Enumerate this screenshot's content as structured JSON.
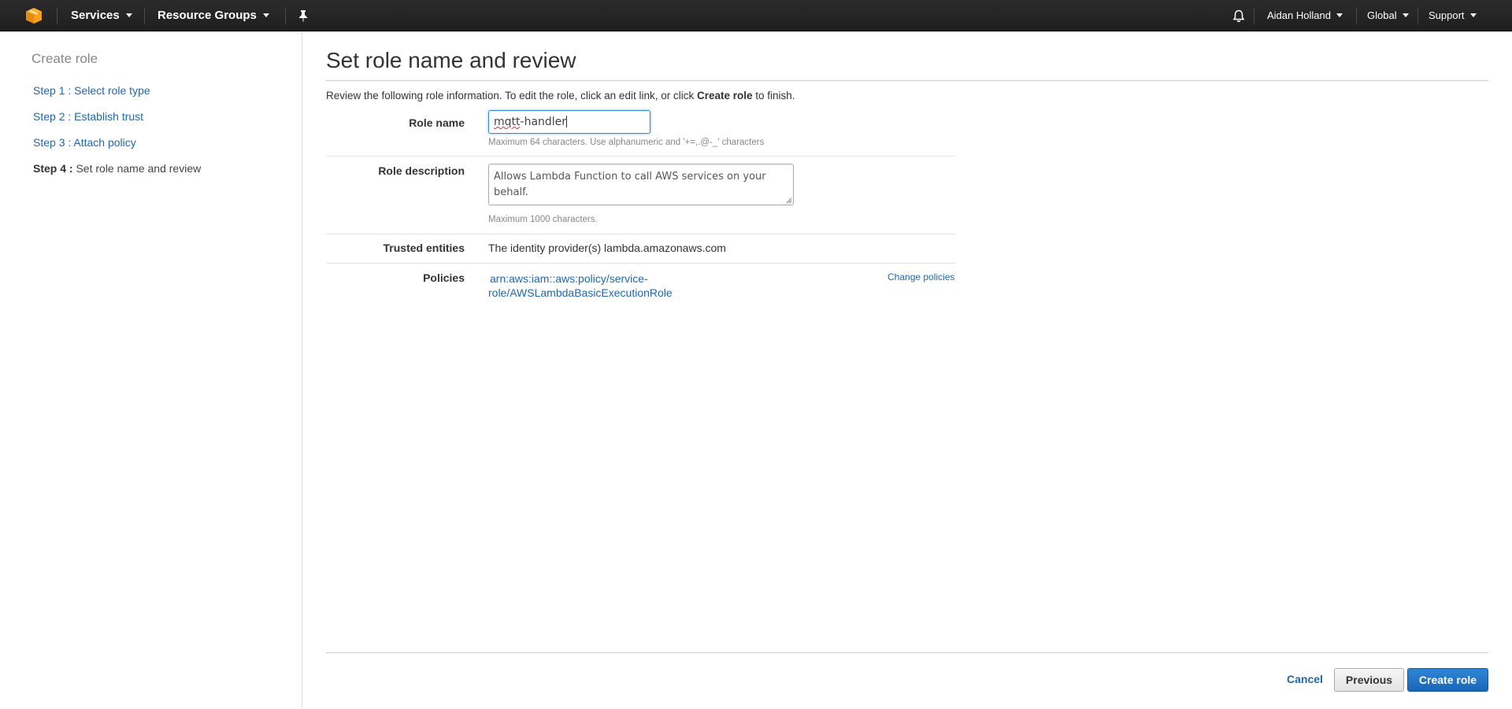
{
  "topbar": {
    "logo_icon": "aws-cube-icon",
    "services_label": "Services",
    "resource_groups_label": "Resource Groups",
    "pin_icon": "pushpin-icon",
    "bell_icon": "bell-icon",
    "user_label": "Aidan Holland",
    "region_label": "Global",
    "support_label": "Support"
  },
  "sidebar": {
    "title": "Create role",
    "steps": [
      {
        "label": "Step 1 : Select role type"
      },
      {
        "label": "Step 2 : Establish trust"
      },
      {
        "label": "Step 3 : Attach policy"
      },
      {
        "num": "Step 4 :",
        "label": "Set role name and review"
      }
    ]
  },
  "main": {
    "title": "Set role name and review",
    "intro_prefix": "Review the following role information. To edit the role, click an edit link, or click ",
    "intro_bold": "Create role",
    "intro_suffix": " to finish.",
    "role_name": {
      "label": "Role name",
      "value_part1": "mqtt",
      "value_part2": "-handler",
      "hint": "Maximum 64 characters. Use alphanumeric and '+=,.@-_' characters"
    },
    "role_description": {
      "label": "Role description",
      "value": "Allows Lambda Function to call AWS services on your behalf.",
      "hint": "Maximum 1000 characters."
    },
    "trusted_entities": {
      "label": "Trusted entities",
      "value": "The identity provider(s) lambda.amazonaws.com"
    },
    "policies": {
      "label": "Policies",
      "policy_line1": "arn:aws:iam::aws:policy/service-",
      "policy_line2": "role/AWSLambdaBasicExecutionRole",
      "change_label": "Change policies"
    }
  },
  "footer": {
    "cancel_label": "Cancel",
    "previous_label": "Previous",
    "create_label": "Create role"
  },
  "colors": {
    "topbar": "#232323",
    "link": "#1e67b1",
    "primary_button": "#1a66b8",
    "logo": "#f7a11a"
  }
}
